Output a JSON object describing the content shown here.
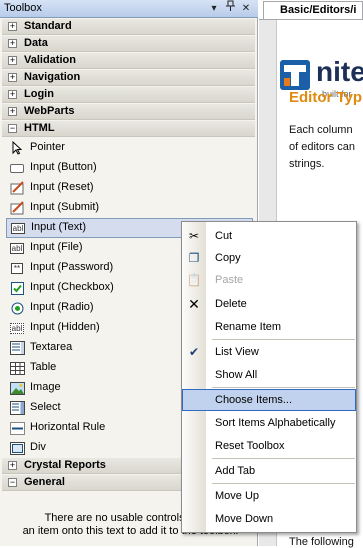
{
  "toolbox": {
    "title": "Toolbox",
    "dropdown_glyph": "▾",
    "pin_glyph": "ᚁ",
    "close_glyph": "✕",
    "categories_top": [
      {
        "label": "Standard",
        "expander": "+"
      },
      {
        "label": "Data",
        "expander": "+"
      },
      {
        "label": "Validation",
        "expander": "+"
      },
      {
        "label": "Navigation",
        "expander": "+"
      },
      {
        "label": "Login",
        "expander": "+"
      },
      {
        "label": "WebParts",
        "expander": "+"
      },
      {
        "label": "HTML",
        "expander": "−"
      }
    ],
    "html_items": [
      {
        "label": "Pointer",
        "icon": "pointer-icon"
      },
      {
        "label": "Input (Button)",
        "icon": "input-button-icon"
      },
      {
        "label": "Input (Reset)",
        "icon": "input-reset-icon"
      },
      {
        "label": "Input (Submit)",
        "icon": "input-submit-icon"
      },
      {
        "label": "Input (Text)",
        "icon": "input-text-icon",
        "icon_text": "abl"
      },
      {
        "label": "Input (File)",
        "icon": "input-file-icon",
        "icon_text": "abl"
      },
      {
        "label": "Input (Password)",
        "icon": "input-password-icon",
        "icon_text": "**"
      },
      {
        "label": "Input (Checkbox)",
        "icon": "checkbox-icon"
      },
      {
        "label": "Input (Radio)",
        "icon": "radio-icon"
      },
      {
        "label": "Input (Hidden)",
        "icon": "input-hidden-icon",
        "icon_text": "abl"
      },
      {
        "label": "Textarea",
        "icon": "textarea-icon"
      },
      {
        "label": "Table",
        "icon": "table-icon"
      },
      {
        "label": "Image",
        "icon": "image-icon"
      },
      {
        "label": "Select",
        "icon": "select-icon"
      },
      {
        "label": "Horizontal Rule",
        "icon": "horizontal-rule-icon"
      },
      {
        "label": "Div",
        "icon": "div-icon"
      }
    ],
    "categories_bottom": [
      {
        "label": "Crystal Reports",
        "expander": "+"
      },
      {
        "label": "General",
        "expander": "−"
      }
    ],
    "empty_message_line1": "There are no usable controls in this",
    "empty_message_line2": "an item onto this text to add it to the toolbox."
  },
  "document": {
    "tab_label": "Basic/Editors/i",
    "logo_text": "nite",
    "logo_sub": "built for",
    "heading": "Editor Typ",
    "lines": [
      "Each column",
      "of editors can",
      "strings."
    ],
    "footer_line": "The following"
  },
  "context_menu": {
    "items": [
      {
        "label": "Cut",
        "icon": "scissors-icon",
        "glyph": "✂",
        "disabled": false
      },
      {
        "label": "Copy",
        "icon": "copy-icon",
        "glyph": "❐",
        "disabled": false
      },
      {
        "label": "Paste",
        "icon": "paste-icon",
        "glyph": "📋",
        "disabled": true
      },
      {
        "label": "Delete",
        "icon": "delete-icon",
        "glyph": "✕",
        "disabled": false
      },
      {
        "label": "Rename Item",
        "disabled": false
      },
      {
        "label": "List View",
        "icon": "checkmark-icon",
        "glyph": "✔",
        "disabled": false
      },
      {
        "label": "Show All",
        "disabled": false
      },
      {
        "label": "Choose Items...",
        "disabled": false,
        "highlighted": true
      },
      {
        "label": "Sort Items Alphabetically",
        "disabled": false
      },
      {
        "label": "Reset Toolbox",
        "disabled": false
      },
      {
        "label": "Add Tab",
        "disabled": false
      },
      {
        "label": "Move Up",
        "disabled": false
      },
      {
        "label": "Move Down",
        "disabled": false
      }
    ]
  },
  "colors": {
    "selection": "#d4dcee",
    "menu_highlight": "#c1d2ee",
    "menu_highlight_border": "#316ac5",
    "heading_orange": "#e08a10"
  }
}
